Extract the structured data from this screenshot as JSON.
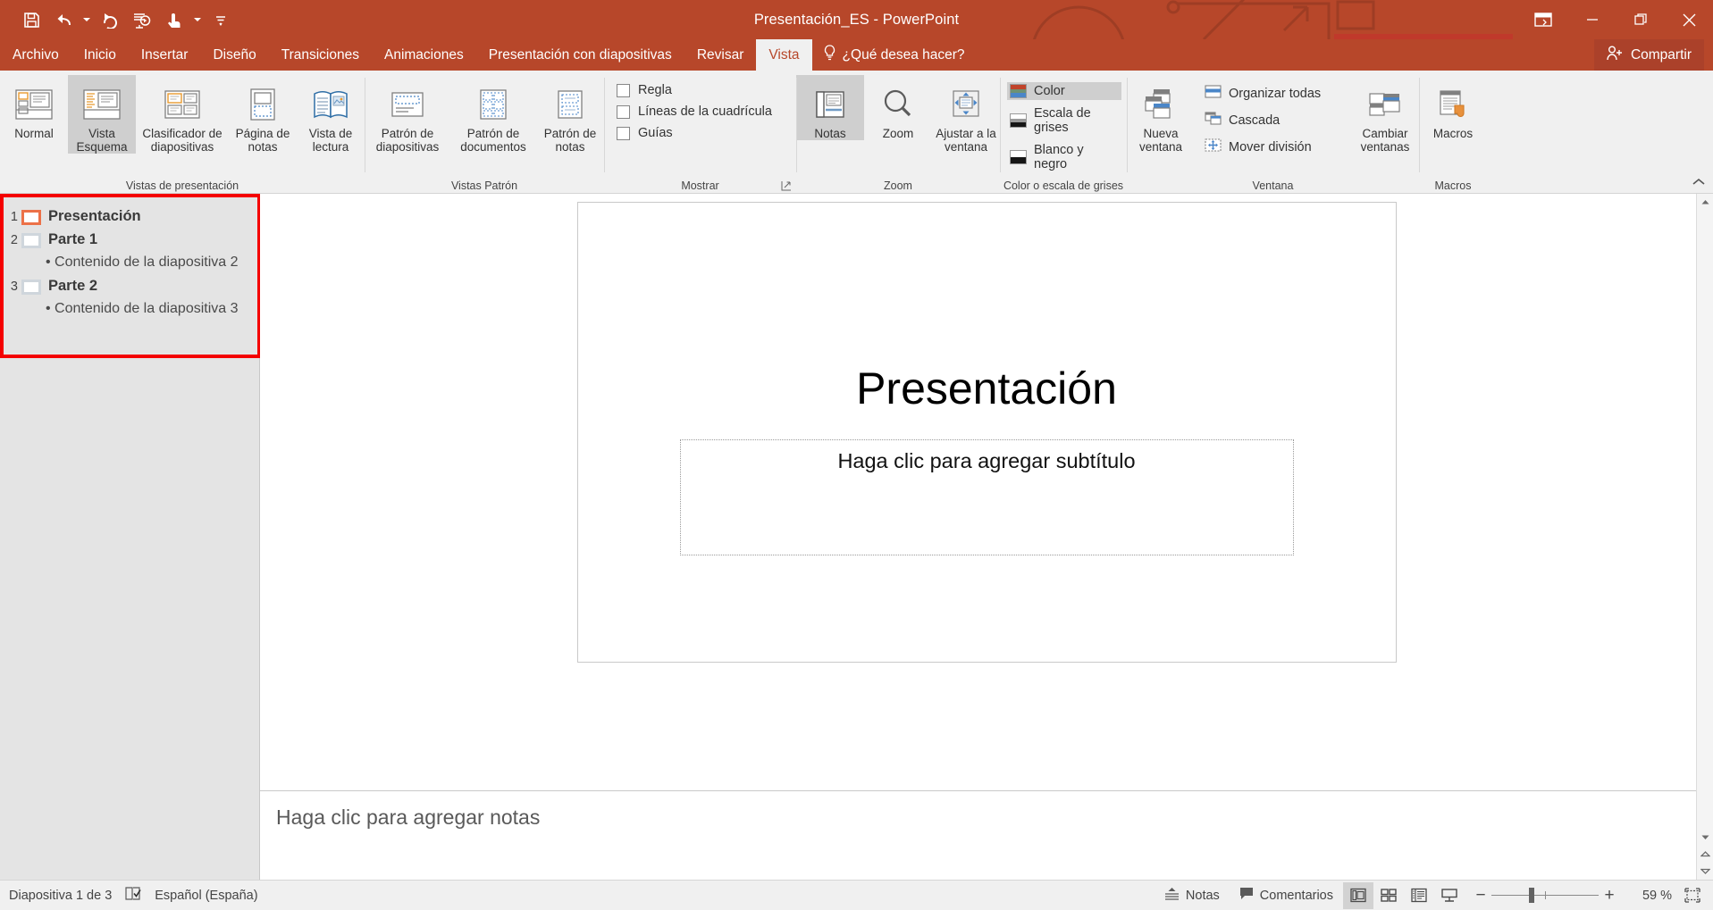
{
  "window": {
    "title": "Presentación_ES - PowerPoint",
    "quick_access": [
      {
        "name": "save-icon",
        "label": "Guardar"
      },
      {
        "name": "undo-icon",
        "label": "Deshacer"
      },
      {
        "name": "redo-icon",
        "label": "Rehacer"
      },
      {
        "name": "start-presentation-icon",
        "label": "Comenzar presentación con diapositivas"
      },
      {
        "name": "touch-mode-icon",
        "label": "Modo mouse/táctil"
      },
      {
        "name": "customize-qat-icon",
        "label": "Personalizar barra de herramientas de acceso rápido"
      }
    ],
    "controls": [
      {
        "name": "ribbon-display-options-icon",
        "label": "Opciones de presentación de la cinta"
      },
      {
        "name": "minimize-icon",
        "label": "Minimizar"
      },
      {
        "name": "restore-icon",
        "label": "Restaurar"
      },
      {
        "name": "close-icon",
        "label": "Cerrar"
      }
    ]
  },
  "tabs": [
    {
      "label": "Archivo",
      "active": false
    },
    {
      "label": "Inicio",
      "active": false
    },
    {
      "label": "Insertar",
      "active": false
    },
    {
      "label": "Diseño",
      "active": false
    },
    {
      "label": "Transiciones",
      "active": false
    },
    {
      "label": "Animaciones",
      "active": false
    },
    {
      "label": "Presentación con diapositivas",
      "active": false
    },
    {
      "label": "Revisar",
      "active": false
    },
    {
      "label": "Vista",
      "active": true
    }
  ],
  "tell_me": "¿Qué desea hacer?",
  "share_label": "Compartir",
  "ribbon": {
    "groups": [
      {
        "label": "Vistas de presentación",
        "buttons": [
          {
            "label": "Normal",
            "icon": "normal-view-icon",
            "selected": false
          },
          {
            "label": "Vista Esquema",
            "icon": "outline-view-icon",
            "selected": true
          },
          {
            "label": "Clasificador de diapositivas",
            "icon": "slide-sorter-icon",
            "selected": false
          },
          {
            "label": "Página de notas",
            "icon": "notes-page-icon",
            "selected": false
          },
          {
            "label": "Vista de lectura",
            "icon": "reading-view-icon",
            "selected": false
          }
        ]
      },
      {
        "label": "Vistas Patrón",
        "buttons": [
          {
            "label": "Patrón de diapositivas",
            "icon": "slide-master-icon",
            "selected": false
          },
          {
            "label": "Patrón de documentos",
            "icon": "handout-master-icon",
            "selected": false
          },
          {
            "label": "Patrón de notas",
            "icon": "notes-master-icon",
            "selected": false
          }
        ]
      },
      {
        "label": "Mostrar",
        "checkboxes": [
          {
            "label": "Regla",
            "checked": false
          },
          {
            "label": "Líneas de la cuadrícula",
            "checked": false
          },
          {
            "label": "Guías",
            "checked": false
          }
        ]
      },
      {
        "label": "Zoom",
        "buttons": [
          {
            "label": "Notas",
            "icon": "notes-pane-icon",
            "selected": true
          },
          {
            "label": "Zoom",
            "icon": "magnifier-icon",
            "selected": false
          },
          {
            "label": "Ajustar a la ventana",
            "icon": "fit-window-icon",
            "selected": false
          }
        ]
      },
      {
        "label": "Color o escala de grises",
        "list": [
          {
            "label": "Color",
            "icon": "color-swatch-icon",
            "selected": true
          },
          {
            "label": "Escala de grises",
            "icon": "grayscale-swatch-icon",
            "selected": false
          },
          {
            "label": "Blanco y negro",
            "icon": "blackwhite-swatch-icon",
            "selected": false
          }
        ]
      },
      {
        "label": "Ventana",
        "buttons": [
          {
            "label": "Nueva ventana",
            "icon": "new-window-icon",
            "selected": false
          },
          {
            "label": "Cambiar ventanas",
            "icon": "switch-windows-icon",
            "selected": false
          }
        ],
        "list": [
          {
            "label": "Organizar todas",
            "icon": "arrange-all-icon",
            "selected": false
          },
          {
            "label": "Cascada",
            "icon": "cascade-icon",
            "selected": false
          },
          {
            "label": "Mover división",
            "icon": "move-split-icon",
            "selected": false
          }
        ]
      },
      {
        "label": "Macros",
        "buttons": [
          {
            "label": "Macros",
            "icon": "macros-icon",
            "selected": false
          }
        ]
      }
    ]
  },
  "outline": {
    "slides": [
      {
        "number": "1",
        "title": "Presentación",
        "current": true,
        "bullets": []
      },
      {
        "number": "2",
        "title": "Parte 1",
        "current": false,
        "bullets": [
          "Contenido de la diapositiva 2"
        ]
      },
      {
        "number": "3",
        "title": "Parte 2",
        "current": false,
        "bullets": [
          "Contenido de la diapositiva 3"
        ]
      }
    ],
    "highlight_color": "#f40000"
  },
  "slide": {
    "title": "Presentación",
    "subtitle_placeholder": "Haga clic para agregar subtítulo"
  },
  "notes": {
    "placeholder": "Haga clic para agregar notas"
  },
  "status": {
    "slide_counter": "Diapositiva 1 de 3",
    "spellcheck_icon": "spellcheck-icon",
    "language": "Español (España)",
    "notes_label": "Notas",
    "comments_label": "Comentarios",
    "views": [
      {
        "name": "view-normal-icon",
        "selected": true
      },
      {
        "name": "view-slide-sorter-icon",
        "selected": false
      },
      {
        "name": "view-reading-icon",
        "selected": false
      },
      {
        "name": "view-slideshow-icon",
        "selected": false
      }
    ],
    "zoom_out": "−",
    "zoom_in": "+",
    "zoom_level": "59 %",
    "fit_icon": "fit-slide-icon"
  },
  "colors": {
    "accent": "#b7472a",
    "selection": "#ec7148",
    "annotation": "#f40000"
  }
}
